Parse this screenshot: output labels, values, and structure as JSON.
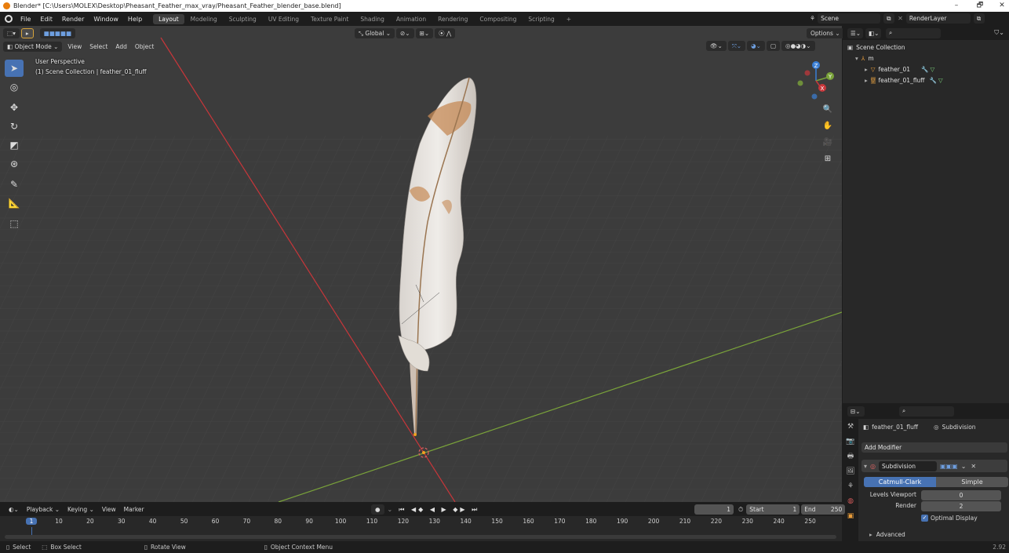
{
  "window": {
    "title": "Blender* [C:\\Users\\MOLEX\\Desktop\\Pheasant_Feather_max_vray/Pheasant_Feather_blender_base.blend]",
    "minimize": "–",
    "restore": "🗗",
    "close": "✕"
  },
  "menu": [
    "File",
    "Edit",
    "Render",
    "Window",
    "Help"
  ],
  "workspaces": [
    "Layout",
    "Modeling",
    "Sculpting",
    "UV Editing",
    "Texture Paint",
    "Shading",
    "Animation",
    "Rendering",
    "Compositing",
    "Scripting"
  ],
  "active_workspace": "Layout",
  "add_workspace": "+",
  "scene": {
    "label": "Scene",
    "render_layer": "RenderLayer"
  },
  "viewport": {
    "mode": "Object Mode",
    "menus": [
      "View",
      "Select",
      "Add",
      "Object"
    ],
    "transform_orientation": "Global",
    "options_label": "Options",
    "perspective_label": "User Perspective",
    "collection_label": "(1) Scene Collection | feather_01_fluff",
    "gizmo_axes": {
      "z": "Z",
      "y": "Y",
      "x": "X"
    }
  },
  "outliner": {
    "root": "Scene Collection",
    "collection": "m",
    "items": [
      "feather_01",
      "feather_01_fluff"
    ]
  },
  "properties": {
    "object_name": "feather_01_fluff",
    "modifier_breadcrumb": "Subdivision",
    "add_modifier": "Add Modifier",
    "modifier_name": "Subdivision",
    "subdiv_types": [
      "Catmull-Clark",
      "Simple"
    ],
    "active_type": "Catmull-Clark",
    "levels_viewport_label": "Levels Viewport",
    "levels_viewport_value": "0",
    "render_label": "Render",
    "render_value": "2",
    "optimal_display": "Optimal Display",
    "advanced": "Advanced"
  },
  "timeline": {
    "menus": [
      "Playback",
      "Keying",
      "View",
      "Marker"
    ],
    "current_frame": "1",
    "start_label": "Start",
    "start_value": "1",
    "end_label": "End",
    "end_value": "250",
    "ruler": [
      "1",
      "10",
      "20",
      "30",
      "40",
      "50",
      "60",
      "70",
      "80",
      "90",
      "100",
      "110",
      "120",
      "130",
      "140",
      "150",
      "160",
      "170",
      "180",
      "190",
      "200",
      "210",
      "220",
      "230",
      "240",
      "250"
    ]
  },
  "status": {
    "select": "Select",
    "box_select": "Box Select",
    "rotate_view": "Rotate View",
    "context_menu": "Object Context Menu",
    "version": "2.92"
  },
  "colors": {
    "accent": "#4772b3",
    "x_axis": "#c8363a",
    "y_axis": "#7aa33a",
    "z_axis": "#3a7fd6",
    "viewport_bg": "#3c3c3c"
  }
}
